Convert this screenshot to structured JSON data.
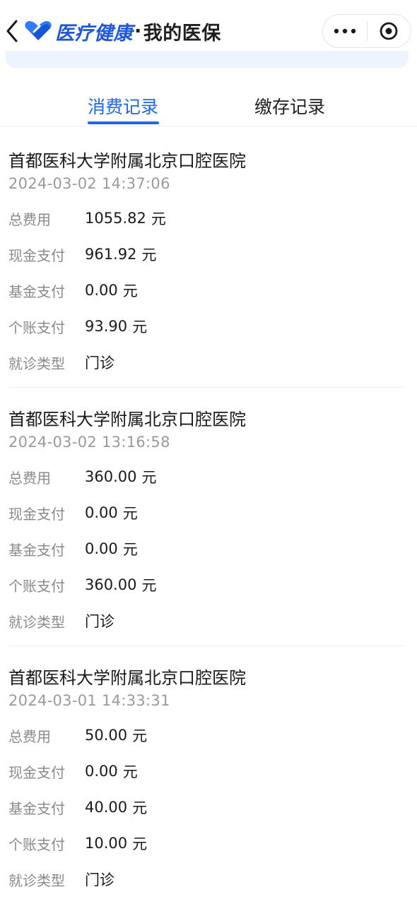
{
  "header": {
    "brand": "医疗健康",
    "dot": "·",
    "subtitle": "我的医保",
    "back_icon": "chevron-left-icon",
    "more_icon": "more-dots-icon",
    "close_icon": "target-close-icon",
    "accent": "#1e58d6"
  },
  "tabs": [
    {
      "label": "消费记录",
      "active": true
    },
    {
      "label": "缴存记录",
      "active": false
    }
  ],
  "labels": {
    "total": "总费用",
    "cash": "现金支付",
    "fund": "基金支付",
    "personal": "个账支付",
    "type": "就诊类型",
    "unit": "元"
  },
  "records": [
    {
      "hospital": "首都医科大学附属北京口腔医院",
      "time": "2024-03-02 14:37:06",
      "total": "1055.82",
      "cash": "961.92",
      "fund": "0.00",
      "personal": "93.90",
      "type": "门诊"
    },
    {
      "hospital": "首都医科大学附属北京口腔医院",
      "time": "2024-03-02 13:16:58",
      "total": "360.00",
      "cash": "0.00",
      "fund": "0.00",
      "personal": "360.00",
      "type": "门诊"
    },
    {
      "hospital": "首都医科大学附属北京口腔医院",
      "time": "2024-03-01 14:33:31",
      "total": "50.00",
      "cash": "0.00",
      "fund": "40.00",
      "personal": "10.00",
      "type": "门诊"
    }
  ]
}
